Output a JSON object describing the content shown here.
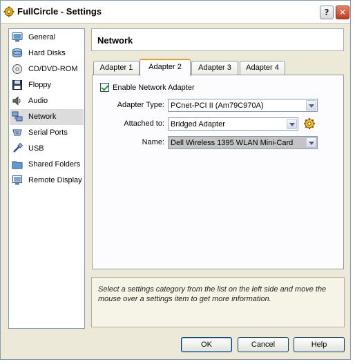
{
  "window": {
    "title": "FullCircle - Settings",
    "help_button": "?",
    "close_button": "✕"
  },
  "sidebar": {
    "items": [
      {
        "label": "General",
        "icon": "monitor-icon"
      },
      {
        "label": "Hard Disks",
        "icon": "hard-disk-icon"
      },
      {
        "label": "CD/DVD-ROM",
        "icon": "cd-icon"
      },
      {
        "label": "Floppy",
        "icon": "floppy-icon"
      },
      {
        "label": "Audio",
        "icon": "speaker-icon"
      },
      {
        "label": "Network",
        "icon": "network-icon",
        "selected": true
      },
      {
        "label": "Serial Ports",
        "icon": "serial-port-icon"
      },
      {
        "label": "USB",
        "icon": "usb-icon"
      },
      {
        "label": "Shared Folders",
        "icon": "folder-icon"
      },
      {
        "label": "Remote Display",
        "icon": "remote-display-icon"
      }
    ]
  },
  "header": {
    "title": "Network"
  },
  "tabs": [
    {
      "label": "Adapter 1"
    },
    {
      "label": "Adapter 2",
      "active": true
    },
    {
      "label": "Adapter 3"
    },
    {
      "label": "Adapter 4"
    }
  ],
  "adapter": {
    "enable_label": "Enable Network Adapter",
    "enabled": true,
    "type_label": "Adapter Type:",
    "type_value": "PCnet-PCI II (Am79C970A)",
    "attached_label": "Attached to:",
    "attached_value": "Bridged Adapter",
    "name_label": "Name:",
    "name_value": "Dell Wireless 1395 WLAN Mini-Card"
  },
  "info": {
    "text": "Select a settings category from the list on the left side and move the mouse over a settings item to get more information."
  },
  "buttons": {
    "ok": "OK",
    "cancel": "Cancel",
    "help": "Help"
  },
  "colors": {
    "tab_accent": "#e69f33",
    "window_bg": "#ece9d8",
    "selection_bg": "#dcdcdc"
  }
}
